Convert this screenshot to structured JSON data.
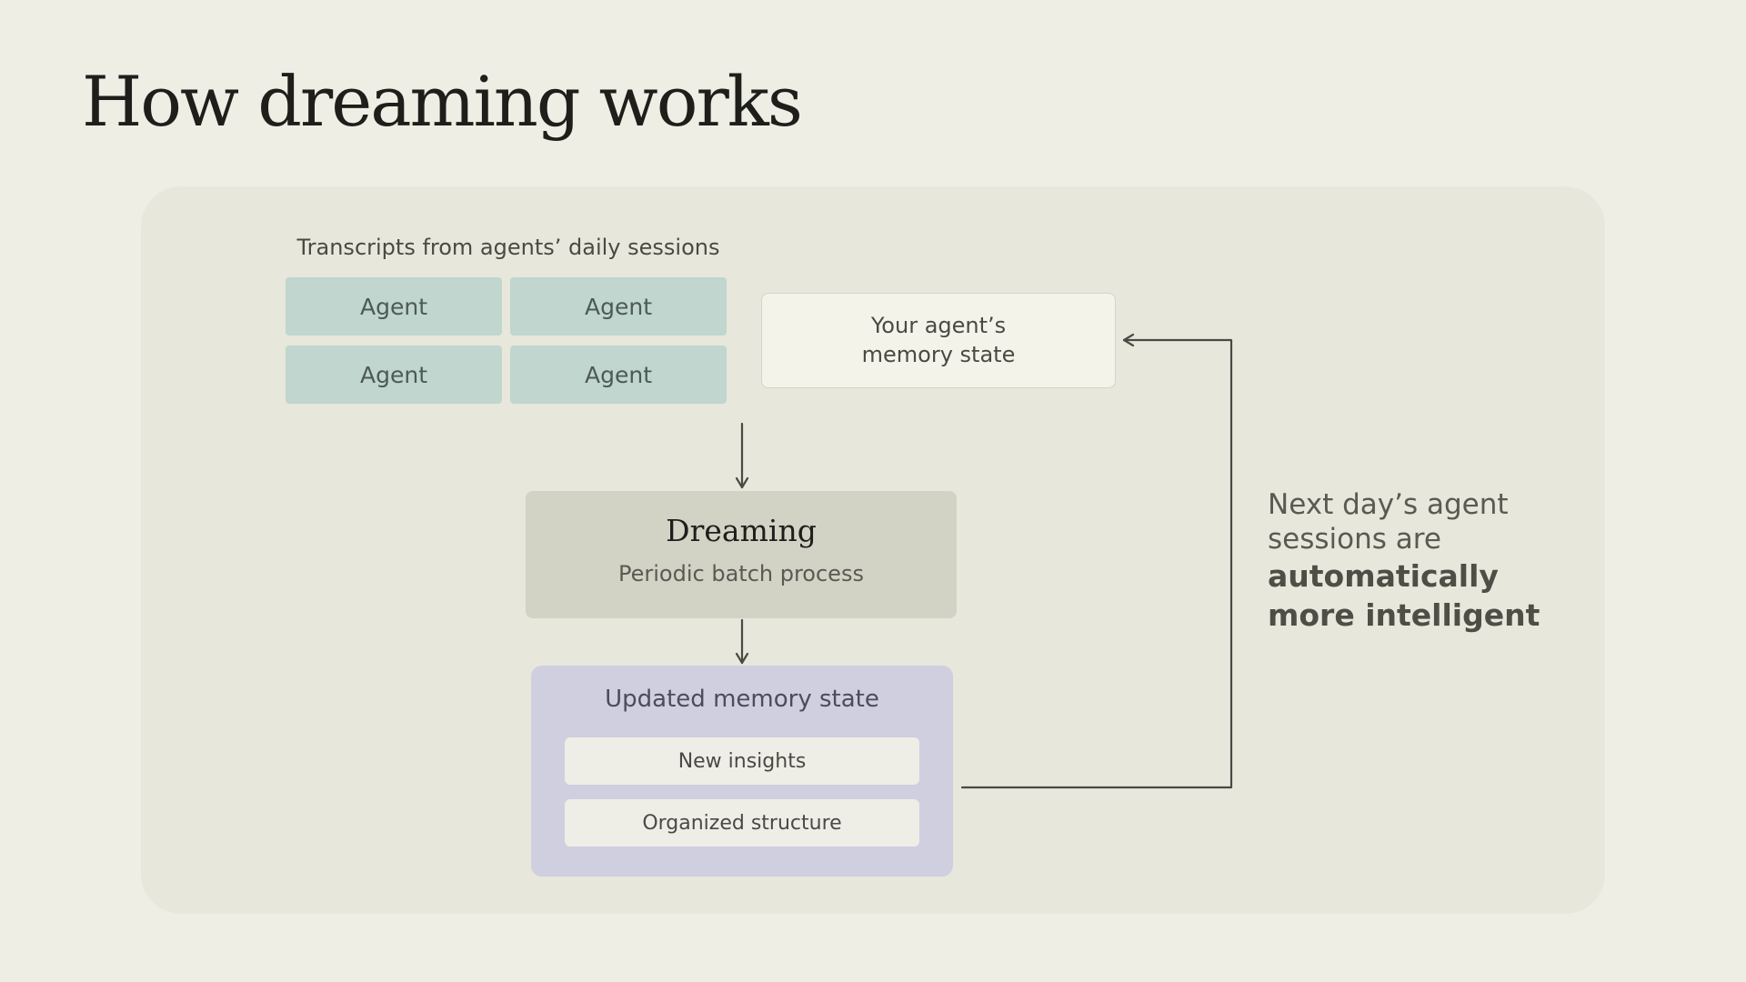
{
  "title": "How dreaming works",
  "diagram": {
    "transcripts_label": "Transcripts from agents’ daily sessions",
    "agents": [
      "Agent",
      "Agent",
      "Agent",
      "Agent"
    ],
    "memory_state": {
      "line1": "Your agent’s",
      "line2": "memory state"
    },
    "dreaming": {
      "title": "Dreaming",
      "subtitle": "Periodic batch process"
    },
    "updated_memory": {
      "title": "Updated memory state",
      "items": [
        "New insights",
        "Organized structure"
      ]
    },
    "caption": {
      "line1": "Next day’s agent",
      "line2": "sessions are",
      "line3": "automatically",
      "line4": "more intelligent"
    }
  },
  "colors": {
    "background": "#efeee4",
    "panel": "#e7e7dc",
    "agent_box": "#c0d6ce",
    "dreaming_box": "#d2d2c5",
    "updated_box": "#cfcfe0",
    "arrow": "#4a4a44"
  }
}
